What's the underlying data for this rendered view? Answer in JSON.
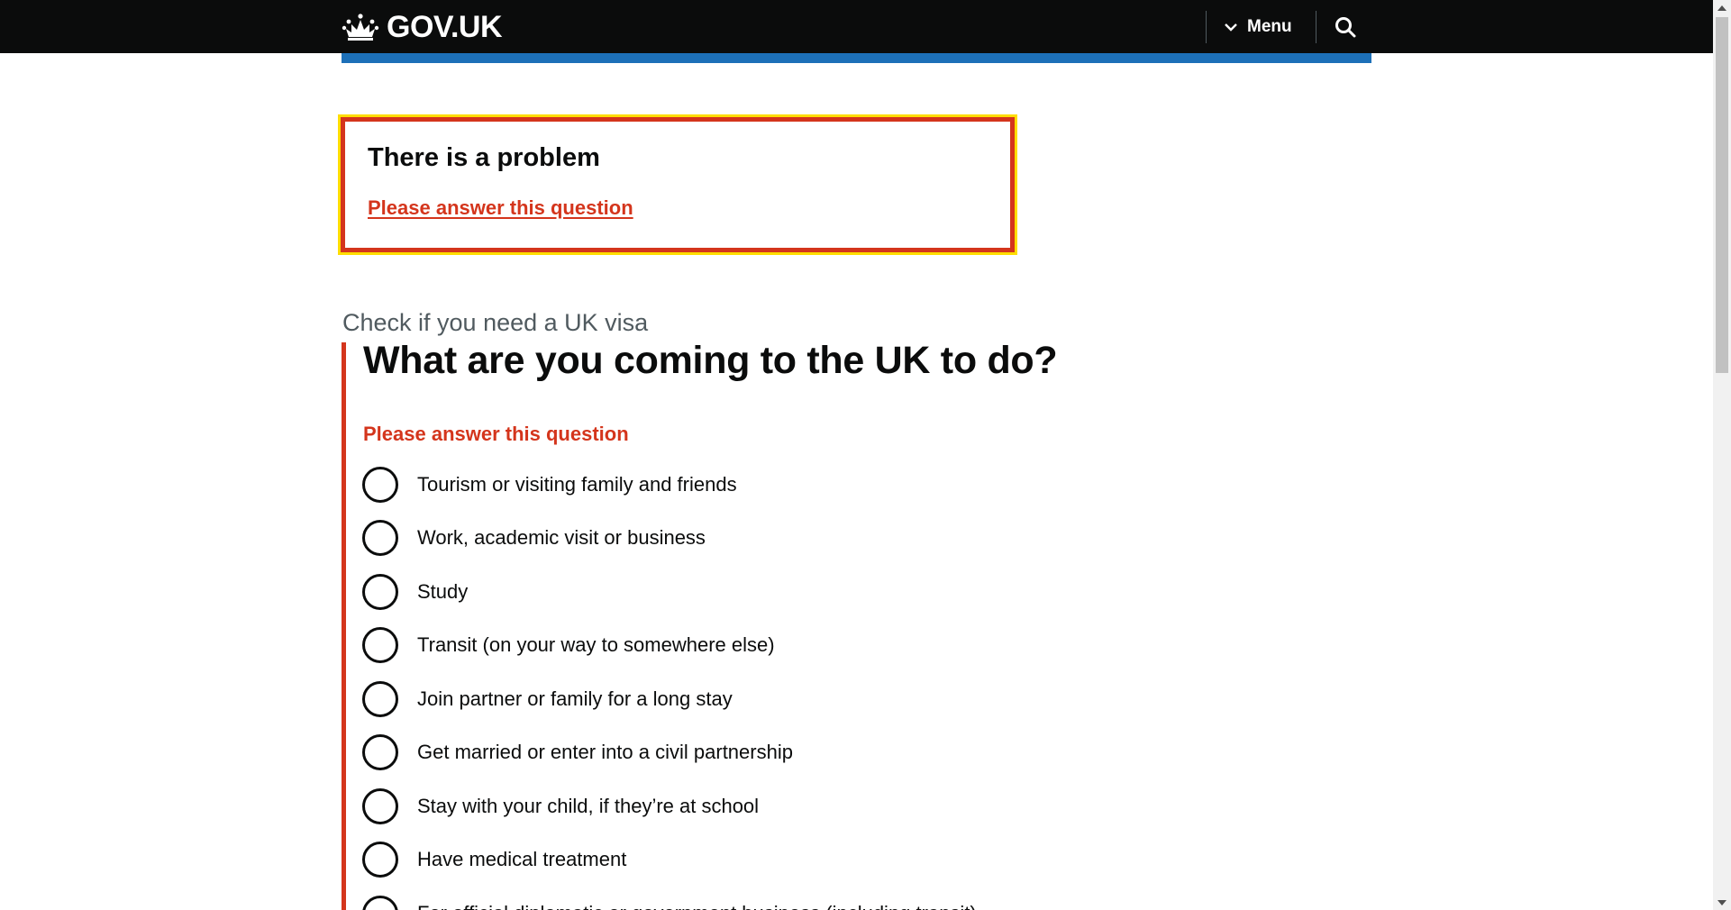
{
  "header": {
    "logo_text": "GOV.UK",
    "menu_label": "Menu",
    "search_icon": "search-icon",
    "colors": {
      "background": "#0b0c0c",
      "accent_bar": "#1d70b8"
    }
  },
  "error_summary": {
    "title": "There is a problem",
    "link_text": "Please answer this question",
    "colors": {
      "border": "#d4351c",
      "focus": "#ffdd00"
    }
  },
  "question": {
    "caption": "Check if you need a UK visa",
    "heading": "What are you coming to the UK to do?",
    "error_message": "Please answer this question",
    "options": [
      {
        "label": "Tourism or visiting family and friends",
        "selected": false
      },
      {
        "label": "Work, academic visit or business",
        "selected": false
      },
      {
        "label": "Study",
        "selected": false
      },
      {
        "label": "Transit (on your way to somewhere else)",
        "selected": false
      },
      {
        "label": "Join partner or family for a long stay",
        "selected": false
      },
      {
        "label": "Get married or enter into a civil partnership",
        "selected": false
      },
      {
        "label": "Stay with your child, if they’re at school",
        "selected": false
      },
      {
        "label": "Have medical treatment",
        "selected": false
      },
      {
        "label": "For official diplomatic or government business (including transit)",
        "selected": false
      }
    ]
  }
}
